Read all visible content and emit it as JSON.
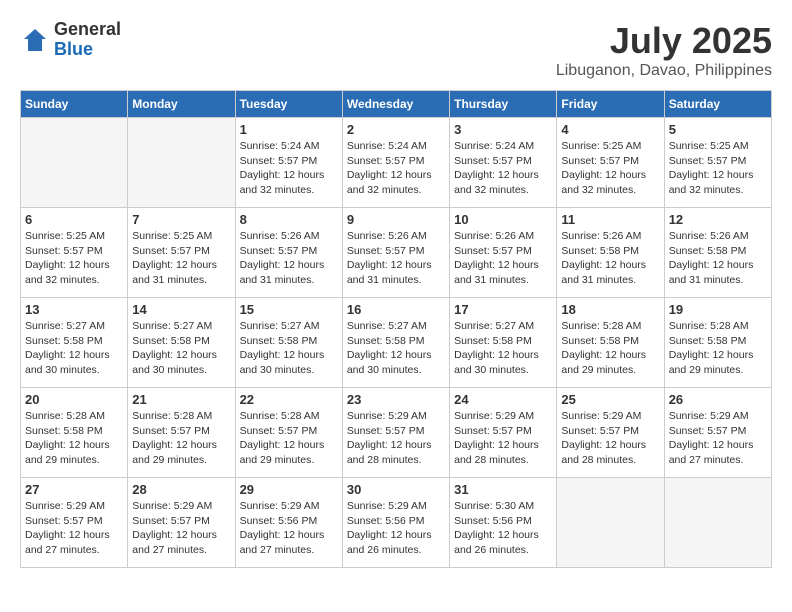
{
  "logo": {
    "general": "General",
    "blue": "Blue"
  },
  "header": {
    "month": "July 2025",
    "location": "Libuganon, Davao, Philippines"
  },
  "weekdays": [
    "Sunday",
    "Monday",
    "Tuesday",
    "Wednesday",
    "Thursday",
    "Friday",
    "Saturday"
  ],
  "weeks": [
    [
      {
        "day": null
      },
      {
        "day": null
      },
      {
        "day": 1,
        "sunrise": "Sunrise: 5:24 AM",
        "sunset": "Sunset: 5:57 PM",
        "daylight": "Daylight: 12 hours and 32 minutes."
      },
      {
        "day": 2,
        "sunrise": "Sunrise: 5:24 AM",
        "sunset": "Sunset: 5:57 PM",
        "daylight": "Daylight: 12 hours and 32 minutes."
      },
      {
        "day": 3,
        "sunrise": "Sunrise: 5:24 AM",
        "sunset": "Sunset: 5:57 PM",
        "daylight": "Daylight: 12 hours and 32 minutes."
      },
      {
        "day": 4,
        "sunrise": "Sunrise: 5:25 AM",
        "sunset": "Sunset: 5:57 PM",
        "daylight": "Daylight: 12 hours and 32 minutes."
      },
      {
        "day": 5,
        "sunrise": "Sunrise: 5:25 AM",
        "sunset": "Sunset: 5:57 PM",
        "daylight": "Daylight: 12 hours and 32 minutes."
      }
    ],
    [
      {
        "day": 6,
        "sunrise": "Sunrise: 5:25 AM",
        "sunset": "Sunset: 5:57 PM",
        "daylight": "Daylight: 12 hours and 32 minutes."
      },
      {
        "day": 7,
        "sunrise": "Sunrise: 5:25 AM",
        "sunset": "Sunset: 5:57 PM",
        "daylight": "Daylight: 12 hours and 31 minutes."
      },
      {
        "day": 8,
        "sunrise": "Sunrise: 5:26 AM",
        "sunset": "Sunset: 5:57 PM",
        "daylight": "Daylight: 12 hours and 31 minutes."
      },
      {
        "day": 9,
        "sunrise": "Sunrise: 5:26 AM",
        "sunset": "Sunset: 5:57 PM",
        "daylight": "Daylight: 12 hours and 31 minutes."
      },
      {
        "day": 10,
        "sunrise": "Sunrise: 5:26 AM",
        "sunset": "Sunset: 5:57 PM",
        "daylight": "Daylight: 12 hours and 31 minutes."
      },
      {
        "day": 11,
        "sunrise": "Sunrise: 5:26 AM",
        "sunset": "Sunset: 5:58 PM",
        "daylight": "Daylight: 12 hours and 31 minutes."
      },
      {
        "day": 12,
        "sunrise": "Sunrise: 5:26 AM",
        "sunset": "Sunset: 5:58 PM",
        "daylight": "Daylight: 12 hours and 31 minutes."
      }
    ],
    [
      {
        "day": 13,
        "sunrise": "Sunrise: 5:27 AM",
        "sunset": "Sunset: 5:58 PM",
        "daylight": "Daylight: 12 hours and 30 minutes."
      },
      {
        "day": 14,
        "sunrise": "Sunrise: 5:27 AM",
        "sunset": "Sunset: 5:58 PM",
        "daylight": "Daylight: 12 hours and 30 minutes."
      },
      {
        "day": 15,
        "sunrise": "Sunrise: 5:27 AM",
        "sunset": "Sunset: 5:58 PM",
        "daylight": "Daylight: 12 hours and 30 minutes."
      },
      {
        "day": 16,
        "sunrise": "Sunrise: 5:27 AM",
        "sunset": "Sunset: 5:58 PM",
        "daylight": "Daylight: 12 hours and 30 minutes."
      },
      {
        "day": 17,
        "sunrise": "Sunrise: 5:27 AM",
        "sunset": "Sunset: 5:58 PM",
        "daylight": "Daylight: 12 hours and 30 minutes."
      },
      {
        "day": 18,
        "sunrise": "Sunrise: 5:28 AM",
        "sunset": "Sunset: 5:58 PM",
        "daylight": "Daylight: 12 hours and 29 minutes."
      },
      {
        "day": 19,
        "sunrise": "Sunrise: 5:28 AM",
        "sunset": "Sunset: 5:58 PM",
        "daylight": "Daylight: 12 hours and 29 minutes."
      }
    ],
    [
      {
        "day": 20,
        "sunrise": "Sunrise: 5:28 AM",
        "sunset": "Sunset: 5:58 PM",
        "daylight": "Daylight: 12 hours and 29 minutes."
      },
      {
        "day": 21,
        "sunrise": "Sunrise: 5:28 AM",
        "sunset": "Sunset: 5:57 PM",
        "daylight": "Daylight: 12 hours and 29 minutes."
      },
      {
        "day": 22,
        "sunrise": "Sunrise: 5:28 AM",
        "sunset": "Sunset: 5:57 PM",
        "daylight": "Daylight: 12 hours and 29 minutes."
      },
      {
        "day": 23,
        "sunrise": "Sunrise: 5:29 AM",
        "sunset": "Sunset: 5:57 PM",
        "daylight": "Daylight: 12 hours and 28 minutes."
      },
      {
        "day": 24,
        "sunrise": "Sunrise: 5:29 AM",
        "sunset": "Sunset: 5:57 PM",
        "daylight": "Daylight: 12 hours and 28 minutes."
      },
      {
        "day": 25,
        "sunrise": "Sunrise: 5:29 AM",
        "sunset": "Sunset: 5:57 PM",
        "daylight": "Daylight: 12 hours and 28 minutes."
      },
      {
        "day": 26,
        "sunrise": "Sunrise: 5:29 AM",
        "sunset": "Sunset: 5:57 PM",
        "daylight": "Daylight: 12 hours and 27 minutes."
      }
    ],
    [
      {
        "day": 27,
        "sunrise": "Sunrise: 5:29 AM",
        "sunset": "Sunset: 5:57 PM",
        "daylight": "Daylight: 12 hours and 27 minutes."
      },
      {
        "day": 28,
        "sunrise": "Sunrise: 5:29 AM",
        "sunset": "Sunset: 5:57 PM",
        "daylight": "Daylight: 12 hours and 27 minutes."
      },
      {
        "day": 29,
        "sunrise": "Sunrise: 5:29 AM",
        "sunset": "Sunset: 5:56 PM",
        "daylight": "Daylight: 12 hours and 27 minutes."
      },
      {
        "day": 30,
        "sunrise": "Sunrise: 5:29 AM",
        "sunset": "Sunset: 5:56 PM",
        "daylight": "Daylight: 12 hours and 26 minutes."
      },
      {
        "day": 31,
        "sunrise": "Sunrise: 5:30 AM",
        "sunset": "Sunset: 5:56 PM",
        "daylight": "Daylight: 12 hours and 26 minutes."
      },
      {
        "day": null
      },
      {
        "day": null
      }
    ]
  ]
}
